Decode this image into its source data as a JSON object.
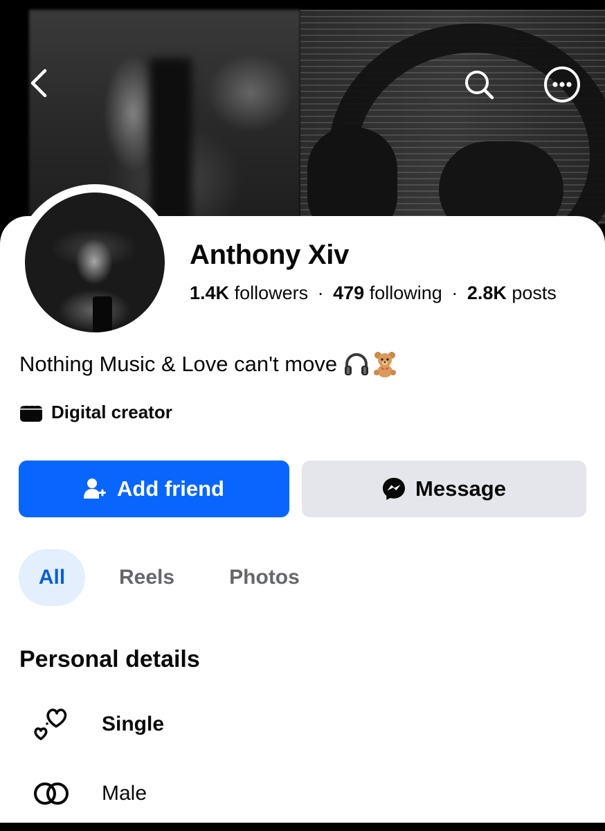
{
  "profile": {
    "name": "Anthony Xiv",
    "followers_count": "1.4K",
    "followers_label": "followers",
    "following_count": "479",
    "following_label": "following",
    "posts_count": "2.8K",
    "posts_label": "posts",
    "separator": "·",
    "bio": "Nothing Music & Love can't move",
    "bio_emojis": [
      "headphone-icon",
      "teddy-bear-icon"
    ],
    "category": "Digital creator",
    "category_icon": "clapperboard-icon"
  },
  "actions": {
    "add_friend_label": "Add friend",
    "add_friend_icon": "add-person-icon",
    "message_label": "Message",
    "message_icon": "messenger-icon"
  },
  "tabs": [
    {
      "label": "All",
      "active": true
    },
    {
      "label": "Reels",
      "active": false
    },
    {
      "label": "Photos",
      "active": false
    }
  ],
  "personal_details": {
    "title": "Personal details",
    "items": [
      {
        "icon": "hearts-icon",
        "text": "Single"
      },
      {
        "icon": "gender-rings-icon",
        "text": "Male"
      }
    ]
  },
  "top_bar": {
    "back_icon": "chevron-left-icon",
    "search_icon": "search-icon",
    "more_icon": "more-icon"
  },
  "colors": {
    "primary": "#0866ff",
    "secondary_button": "#e4e6eb",
    "active_tab_bg": "#e3effd",
    "active_tab_text": "#0a5fd1",
    "text": "#080809",
    "muted_text": "#65676b"
  }
}
